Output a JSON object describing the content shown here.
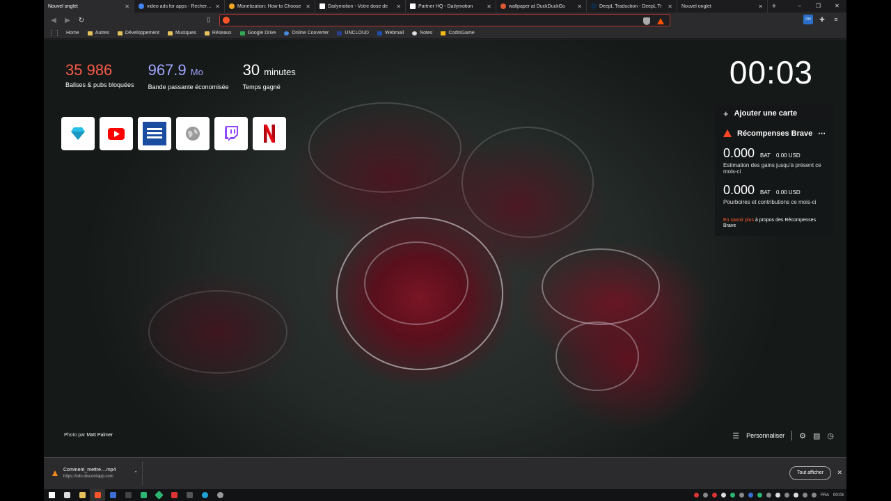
{
  "tabs": [
    {
      "title": "Nouvel onglet",
      "active": true,
      "color": "#2b2b2e"
    },
    {
      "title": "video ads for apps - Recherche",
      "color": "#4285f4"
    },
    {
      "title": "Monetization: How to Choose",
      "color": "#f5a623"
    },
    {
      "title": "Dailymotion - Votre dose de",
      "color": "#ffffff"
    },
    {
      "title": "Partner HQ - Dailymotion",
      "color": "#ffffff"
    },
    {
      "title": "wallpaper at DuckDuckGo",
      "color": "#de5833"
    },
    {
      "title": "DeepL Traduction - DeepL Tr",
      "color": "#0f2b46"
    },
    {
      "title": "Nouvel onglet",
      "color": "#2b2b2e"
    }
  ],
  "window": {
    "minimize": "–",
    "maximize": "❐",
    "close": "✕"
  },
  "omnibox": {
    "value": "",
    "placeholder": ""
  },
  "bookmarks": [
    {
      "label": "Home",
      "type": "page"
    },
    {
      "label": "Autres",
      "type": "folder"
    },
    {
      "label": "Développement",
      "type": "folder"
    },
    {
      "label": "Musiques",
      "type": "folder"
    },
    {
      "label": "Réseaux",
      "type": "folder"
    },
    {
      "label": "Google Drive",
      "type": "drive"
    },
    {
      "label": "Online Converter",
      "type": "page"
    },
    {
      "label": "UNCLOUD",
      "type": "page"
    },
    {
      "label": "Webmail",
      "type": "page"
    },
    {
      "label": "Notes",
      "type": "page"
    },
    {
      "label": "CodinGame",
      "type": "page"
    }
  ],
  "stats": {
    "blocked": {
      "value": "35 986",
      "label": "Balises & pubs bloquées",
      "color": "#fb5a4a"
    },
    "bandwidth": {
      "value": "967.9",
      "unit": "Mo",
      "label": "Bande passante économisée",
      "color": "#a0a5ff"
    },
    "time": {
      "value": "30",
      "unit": "minutes",
      "label": "Temps gagné",
      "color": "#ffffff"
    }
  },
  "clock": "00:03",
  "top_sites": [
    {
      "name": "sketch",
      "icon": "diamond-icon",
      "color": "#28c0e8"
    },
    {
      "name": "youtube",
      "icon": "youtube-icon",
      "color": "#ff0000"
    },
    {
      "name": "news",
      "icon": "list-icon",
      "color": "#1a4da1"
    },
    {
      "name": "web",
      "icon": "globe-icon",
      "color": "#888888"
    },
    {
      "name": "twitch",
      "icon": "twitch-icon",
      "color": "#9146ff"
    },
    {
      "name": "netflix",
      "icon": "netflix-icon",
      "color": "#e50914"
    }
  ],
  "cards": {
    "add_label": "Ajouter une carte",
    "rewards": {
      "title": "Récompenses Brave",
      "menu": "⋯",
      "estimate": {
        "amount": "0.000",
        "unit": "BAT",
        "usd": "0.00 USD",
        "desc": "Estimation des gains jusqu'à présent ce mois-ci"
      },
      "tips": {
        "amount": "0.000",
        "unit": "BAT",
        "usd": "0.00 USD",
        "desc": "Pourboires et contributions ce mois-ci"
      },
      "learn_link": "En savoir plus",
      "learn_text": " à propos des Récompenses Brave"
    }
  },
  "photo_credit": {
    "prefix": "Photo par ",
    "author": "Matt Palmer"
  },
  "customize_label": "Personnaliser",
  "download": {
    "name": "Comment_mettre....mp4",
    "url": "https://cdn.discordapp.com",
    "show_all": "Tout afficher"
  },
  "taskbar": {
    "lang": "FRA",
    "time": "00:03"
  }
}
